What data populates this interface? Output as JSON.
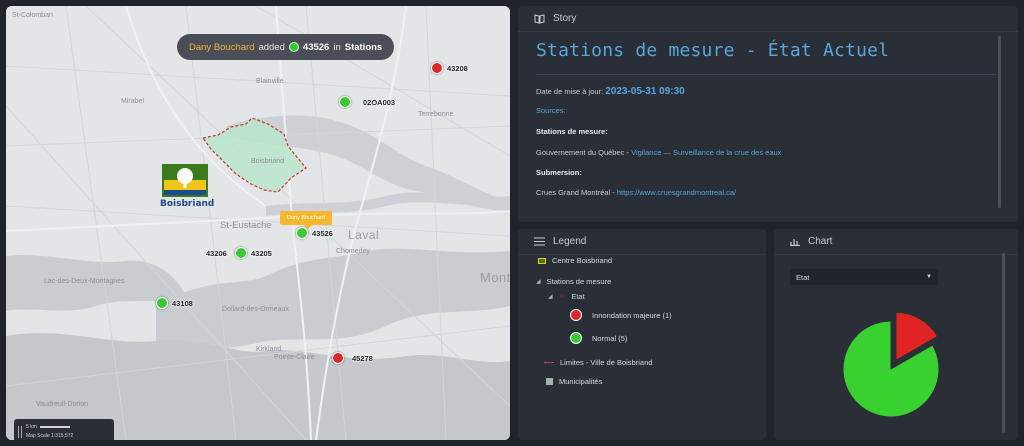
{
  "map": {
    "labels": {
      "st_colomban": "St-Colomban",
      "blainville": "Blainville",
      "mirabel": "Mirabel",
      "st_eustache": "St-Eustache",
      "laval": "Laval",
      "monte": "Mont",
      "lac_deux": "Lac-des-Deux-Montagnes",
      "dollard": "Dollard-des-Ormeaux",
      "kirkland": "Kirkland",
      "pointe_claire": "Pointe-Claire",
      "vaudreuil": "Vaudreuil-Dorion",
      "terrebonne": "Terrebonne",
      "chomedey": "Chomedey",
      "boisbriand": "Boisbriand"
    },
    "notification": {
      "user": "Dany Bouchard",
      "action": "added",
      "station": "43526",
      "in_word": "in",
      "layer": "Stations"
    },
    "tooltip": "Dany Bouchard",
    "logo_text": "Boisbriand",
    "stations": [
      {
        "id": "43208",
        "status": "red"
      },
      {
        "id": "02OA003",
        "status": "green"
      },
      {
        "id": "43526",
        "status": "green"
      },
      {
        "id": "43206",
        "status": "green"
      },
      {
        "id": "43205",
        "status": "green"
      },
      {
        "id": "43108",
        "status": "green"
      },
      {
        "id": "45278",
        "status": "red"
      }
    ],
    "scale": {
      "distance": "5 km",
      "ratio": "Map Scale 1:315,572"
    }
  },
  "story": {
    "header": "Story",
    "title": "Stations de mesure - État Actuel",
    "date_label": "Date de mise à jour:",
    "date_value": "2023-05-31 09:30",
    "sources_label": "Sources:",
    "stations_heading": "Stations de mesure:",
    "gov_text": "Gouvernement du Québec - ",
    "gov_link": "Vigilance — Surveillance de la crue des eaux",
    "submersion_heading": "Submersion:",
    "crues_text": "Crues Grand Montréal - ",
    "crues_link": "https://www.cruesgrandmontreal.ca/"
  },
  "legend": {
    "header": "Legend",
    "items": {
      "centre": "Centre Boisbriand",
      "stations": "Stations de mesure",
      "etat": "Etat",
      "inondation": "Innondation majeure (1)",
      "normal": "Normal (5)",
      "limites": "Limites - Ville de Boisbriand",
      "municipalites": "Municipalités"
    }
  },
  "chart": {
    "header": "Chart",
    "select_value": "Etat"
  },
  "colors": {
    "red": "#d92a2a",
    "green": "#39c934",
    "accent": "#56a7dd",
    "notif_user": "#f3b23a"
  },
  "chart_data": {
    "type": "pie",
    "categories": [
      "Innondation majeure",
      "Normal"
    ],
    "values": [
      1,
      5
    ],
    "colors": [
      "#e02424",
      "#39d12f"
    ]
  }
}
